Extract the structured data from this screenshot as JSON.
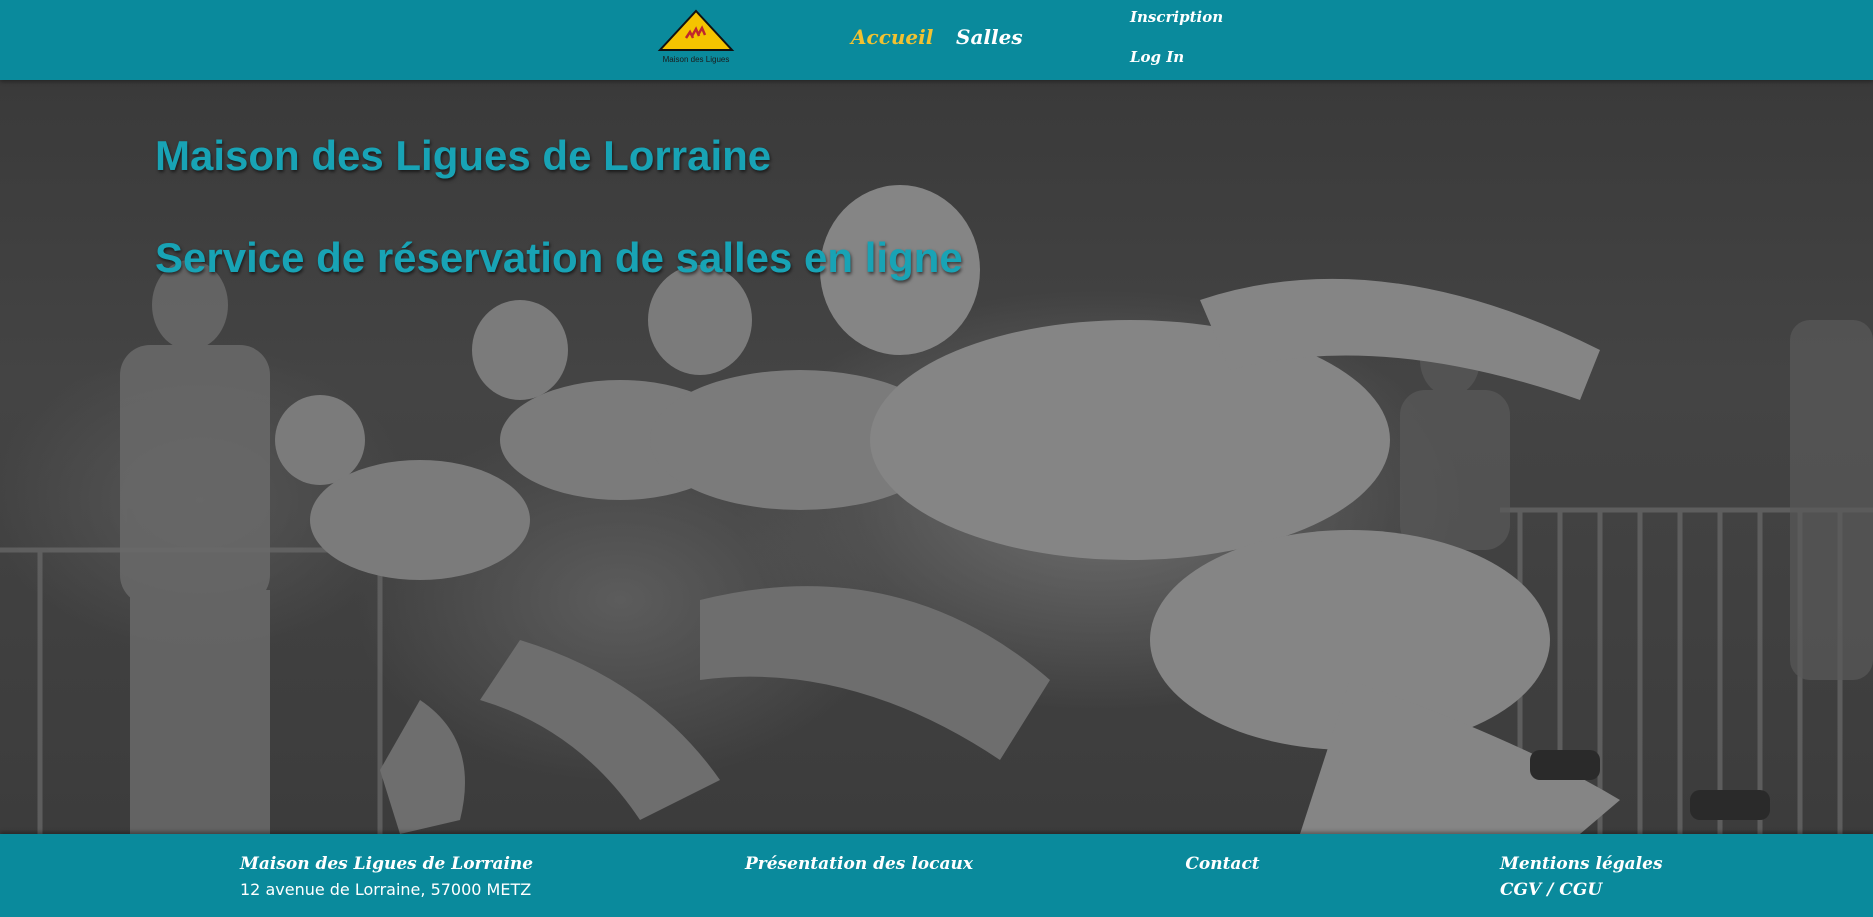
{
  "header": {
    "logo_caption": "Maison des Ligues",
    "nav": {
      "home": "Accueil",
      "rooms": "Salles"
    },
    "account": {
      "register": "Inscription",
      "login": "Log In"
    }
  },
  "hero": {
    "title": "Maison des Ligues de Lorraine",
    "subtitle": "Service de réservation de salles en ligne"
  },
  "footer": {
    "org_name": "Maison des Ligues de Lorraine",
    "address": "12 avenue de Lorraine, 57000 METZ",
    "presentation": "Présentation des locaux",
    "contact": "Contact",
    "legal": "Mentions légales",
    "terms": "CGV / CGU"
  },
  "colors": {
    "brand": "#0a8a9c",
    "active_nav": "#f2c230",
    "hero_title": "#18a3b5"
  }
}
